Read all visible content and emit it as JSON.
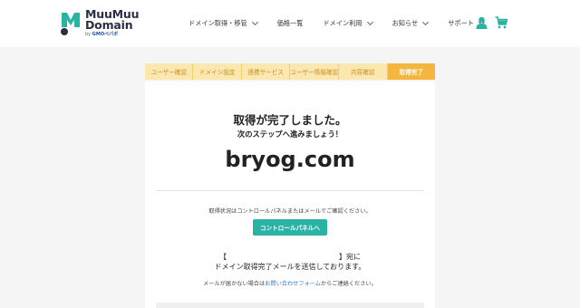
{
  "header": {
    "logo": {
      "line1": "MuuMuu",
      "line2": "Domain",
      "sub_prefix": "by ",
      "sub_brand": "GMOペパボ"
    },
    "nav": [
      {
        "label": "ドメイン取得・移管",
        "dropdown": true
      },
      {
        "label": "価格一覧",
        "dropdown": false
      },
      {
        "label": "ドメイン利用",
        "dropdown": true
      },
      {
        "label": "お知らせ",
        "dropdown": true
      },
      {
        "label": "サポート",
        "dropdown": true
      }
    ],
    "icons": [
      "user-icon",
      "cart-icon"
    ]
  },
  "steps": {
    "items": [
      "ユーザー確認",
      "ドメイン設定",
      "連携サービス",
      "ユーザー情報確認",
      "内容確認",
      "取得完了"
    ],
    "active_index": 5
  },
  "main": {
    "title": "取得が完了しました。",
    "subtitle": "次のステップへ進みましょう！",
    "domain": "bryog.com",
    "status_text": "取得状況はコントロールパネルまたはメールでご確認ください。",
    "control_panel_button": "コントロールパネルへ",
    "address_open": "【",
    "address_close": "】宛に",
    "sent_text": "ドメイン取得完了メールを送信しております。",
    "note_prefix": "メールが届かない場合は",
    "note_link": "お問い合わせフォーム",
    "note_suffix": "からご連絡ください。"
  },
  "colors": {
    "teal": "#29b3a5",
    "step_bg": "#fbe8b0",
    "step_active": "#f4b63e",
    "logo_dark": "#2a2f45",
    "link": "#2f7bd2"
  }
}
